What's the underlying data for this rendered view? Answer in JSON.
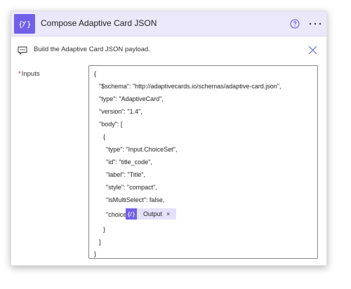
{
  "action": {
    "title": "Compose Adaptive Card JSON",
    "icon": "compose-variable-icon",
    "accent_color": "#7160e8",
    "header_background": "#ece8fb"
  },
  "comment": {
    "icon": "comment-icon",
    "text": "Build the Adaptive Card JSON payload."
  },
  "inputs": {
    "required_marker": "*",
    "label": "Inputs",
    "lines": [
      "{",
      "\"$schema\": \"http://adaptivecards.io/schemas/adaptive-card.json\",",
      "\"type\": \"AdaptiveCard\",",
      "\"version\": \"1.4\",",
      "\"body\": [",
      "{",
      "\"type\": \"Input.ChoiceSet\",",
      "\"id\": \"title_code\",",
      "\"label\": \"Title\",",
      "\"style\": \"compact\",",
      "\"isMultiSelect\": false,",
      "\"choices\":",
      "}",
      "]",
      "}"
    ],
    "token": {
      "label": "Output",
      "remove_glyph": "×",
      "icon": "expression-icon"
    }
  }
}
